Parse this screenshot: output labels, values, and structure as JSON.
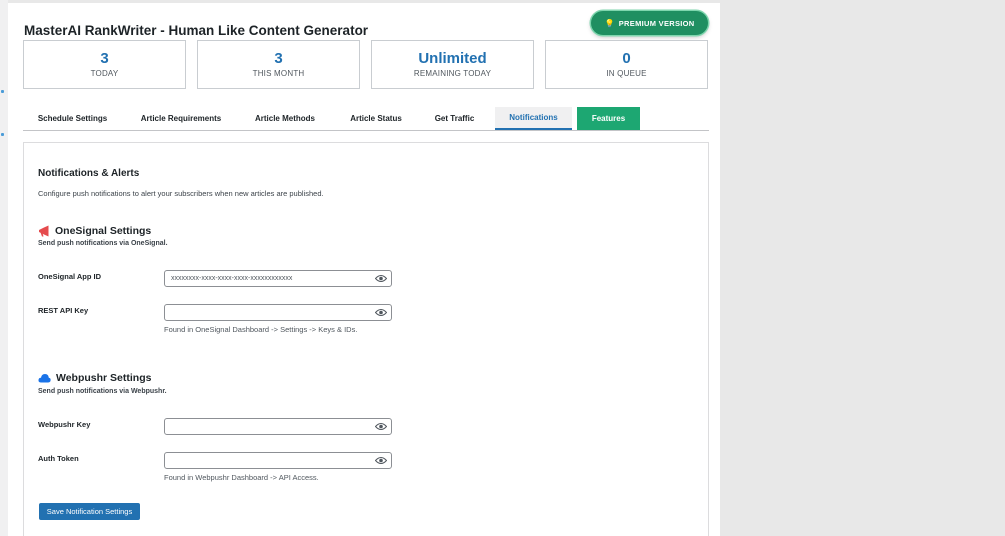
{
  "header": {
    "title": "MasterAI RankWriter - Human Like Content Generator",
    "premium_label": "PREMIUM VERSION",
    "premium_icon": "lightbulb-icon"
  },
  "stats": [
    {
      "value": "3",
      "label": "TODAY"
    },
    {
      "value": "3",
      "label": "THIS MONTH"
    },
    {
      "value": "Unlimited",
      "label": "REMAINING TODAY"
    },
    {
      "value": "0",
      "label": "IN QUEUE"
    }
  ],
  "tabs": [
    {
      "label": "Schedule Settings"
    },
    {
      "label": "Article Requirements"
    },
    {
      "label": "Article Methods"
    },
    {
      "label": "Article Status"
    },
    {
      "label": "Get Traffic"
    },
    {
      "label": "Notifications",
      "active": true
    },
    {
      "label": "Features"
    }
  ],
  "notifications": {
    "heading": "Notifications & Alerts",
    "description": "Configure push notifications to alert your subscribers when new articles are published.",
    "onesignal": {
      "title": "OneSignal Settings",
      "subtitle": "Send push notifications via OneSignal.",
      "app_id_label": "OneSignal App ID",
      "app_id_value": "xxxxxxxx-xxxx-xxxx-xxxx-xxxxxxxxxxxx",
      "rest_key_label": "REST API Key",
      "rest_key_value": "",
      "hint": "Found in OneSignal Dashboard -> Settings -> Keys & IDs."
    },
    "webpushr": {
      "title": "Webpushr Settings",
      "subtitle": "Send push notifications via Webpushr.",
      "key_label": "Webpushr Key",
      "key_value": "",
      "token_label": "Auth Token",
      "token_value": "",
      "hint": "Found in Webpushr Dashboard -> API Access."
    },
    "save_label": "Save Notification Settings"
  },
  "colors": {
    "accent": "#2271b1",
    "premium_green": "#1f8f61",
    "features_green": "#1da772",
    "onesignal_red": "#e54b4d",
    "webpushr_blue": "#1a73e8"
  }
}
